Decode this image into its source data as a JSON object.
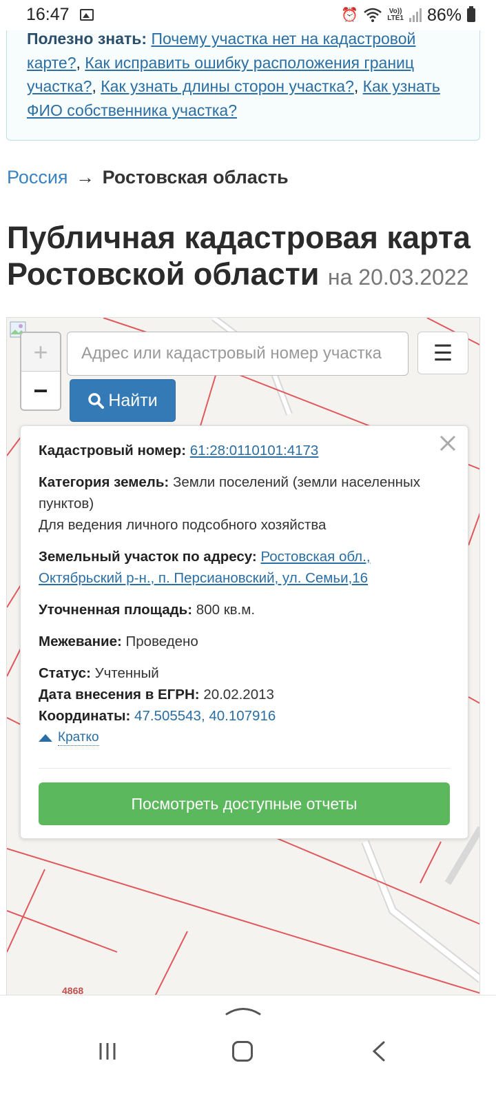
{
  "status_bar": {
    "time": "16:47",
    "battery_pct": "86%",
    "lte_top": "Vo))",
    "lte_bottom": "LTE1"
  },
  "useful": {
    "label": "Полезно знать:",
    "links": [
      "Почему участка нет на кадастровой карте?",
      "Как исправить ошибку расположения границ участка?",
      "Как узнать длины сторон участка?",
      "Как узнать ФИО собственника участка?"
    ],
    "separator": ", "
  },
  "breadcrumb": {
    "root": "Россия",
    "arrow": "→",
    "current": "Ростовская область"
  },
  "title": {
    "main": "Публичная кадастровая карта Ростовской области",
    "date": "на 20.03.2022"
  },
  "map": {
    "zoom_in": "+",
    "zoom_out": "−",
    "search_placeholder": "Адрес или кадастровый номер участка",
    "menu_glyph": "☰",
    "find_label": "Найти",
    "parcel_label": "4868",
    "accent_color": "#e0575c"
  },
  "popup": {
    "cad_label": "Кадастровый номер:",
    "cad_value": "61:28:0110101:4173",
    "cat_label": "Категория земель:",
    "cat_value": "Земли поселений (земли населенных пунктов)",
    "use_value": "Для ведения личного подсобного хозяйства",
    "addr_label": "Земельный участок по адресу:",
    "addr_value": "Ростовская обл., Октябрьский р-н., п. Персиановский, ул. Семьи,16",
    "area_label": "Уточненная площадь:",
    "area_value": "800 кв.м.",
    "survey_label": "Межевание:",
    "survey_value": "Проведено",
    "status_label": "Статус:",
    "status_value": "Учтенный",
    "date_label": "Дата внесения в ЕГРН:",
    "date_value": "20.02.2013",
    "coords_label": "Координаты:",
    "coords_value": "47.505543, 40.107916",
    "brief_label": "Кратко",
    "reports_label": "Посмотреть доступные отчеты"
  }
}
